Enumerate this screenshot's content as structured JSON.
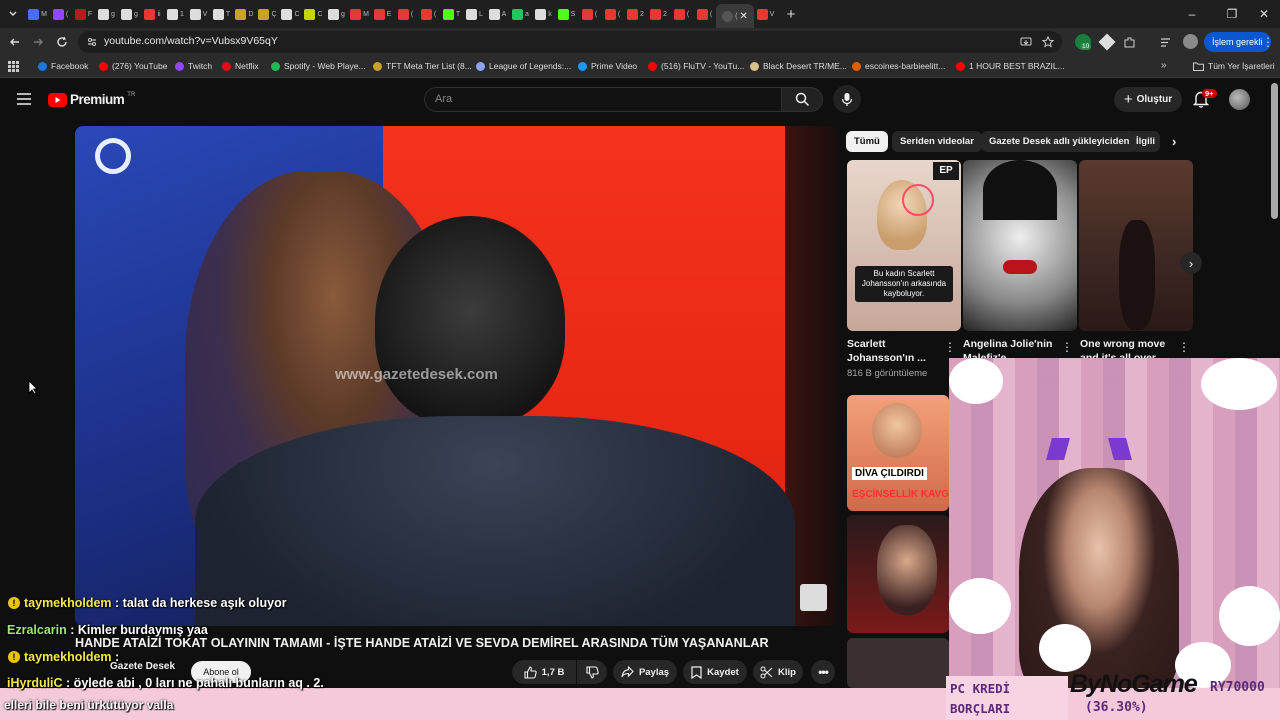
{
  "browser": {
    "tabs": [
      {
        "label": "M",
        "color": "#4a6cf7"
      },
      {
        "label": "(",
        "color": "#9146ff"
      },
      {
        "label": "F",
        "color": "#b71c1c"
      },
      {
        "label": "g",
        "color": "#dddddd"
      },
      {
        "label": "g",
        "color": "#dddddd"
      },
      {
        "label": "ii",
        "color": "#e53935"
      },
      {
        "label": "1",
        "color": "#dddddd"
      },
      {
        "label": "V",
        "color": "#dddddd"
      },
      {
        "label": "T",
        "color": "#dddddd"
      },
      {
        "label": "D",
        "color": "#c9a227"
      },
      {
        "label": "Ç",
        "color": "#c9a227"
      },
      {
        "label": "C",
        "color": "#dddddd"
      },
      {
        "label": "C",
        "color": "#c6d400"
      },
      {
        "label": "g",
        "color": "#dddddd"
      },
      {
        "label": "M",
        "color": "#e53935"
      },
      {
        "label": "E",
        "color": "#e53935"
      },
      {
        "label": "(",
        "color": "#e53935"
      },
      {
        "label": "(",
        "color": "#e53935"
      },
      {
        "label": "T",
        "color": "#53fc18"
      },
      {
        "label": "L",
        "color": "#dddddd"
      },
      {
        "label": "A",
        "color": "#dddddd"
      },
      {
        "label": "a",
        "color": "#22c55e"
      },
      {
        "label": "k",
        "color": "#dddddd"
      },
      {
        "label": "S",
        "color": "#53fc18"
      },
      {
        "label": "(",
        "color": "#e53935"
      },
      {
        "label": "(",
        "color": "#e53935"
      },
      {
        "label": "2",
        "color": "#e53935"
      },
      {
        "label": "2",
        "color": "#e53935"
      },
      {
        "label": "(",
        "color": "#e53935"
      },
      {
        "label": "(",
        "color": "#e53935"
      }
    ],
    "active_tab_label": "(",
    "next_tab_label": "V",
    "url": "youtube.com/watch?v=Vubsx9V65qY",
    "profile_label": "İşlem gerekli",
    "extension_badge": "10",
    "bookmarks": [
      {
        "label": "Facebook",
        "color": "#1877f2"
      },
      {
        "label": "(276) YouTube",
        "color": "#ff0000"
      },
      {
        "label": "Twitch",
        "color": "#9146ff"
      },
      {
        "label": "Netflix",
        "color": "#e50914"
      },
      {
        "label": "Spotify - Web Playe...",
        "color": "#1db954"
      },
      {
        "label": "TFT Meta Tier List (8...",
        "color": "#c9a227"
      },
      {
        "label": "League of Legends:...",
        "color": "#8aa4ff"
      },
      {
        "label": "Prime Video",
        "color": "#1a98ff"
      },
      {
        "label": "(516) FluTV - YouTu...",
        "color": "#ff0000"
      },
      {
        "label": "Black Desert TR/ME...",
        "color": "#d9c08a"
      },
      {
        "label": "escoines-barbieelitt...",
        "color": "#e06000"
      },
      {
        "label": "1 HOUR BEST BRAZIL...",
        "color": "#ff0000"
      }
    ],
    "all_bookmarks_label": "Tüm Yer İşaretleri"
  },
  "youtube": {
    "logo_text": "Premium",
    "logo_region": "TR",
    "search_placeholder": "Ara",
    "create_label": "Oluştur",
    "notif_count": "9+",
    "chips": [
      "Tümü",
      "Seriden videolar",
      "Gazete Desek adlı yükleyiciden",
      "İlgili"
    ],
    "shorts": [
      {
        "title": "Scarlett Johansson'ın ...",
        "views": "816 B görüntüleme",
        "caption": "Bu kadın Scarlett Johansson'ın arkasında kayboluyor.",
        "badge": "EP"
      },
      {
        "title": "Angelina Jolie'nin Malefiz'e",
        "views": ""
      },
      {
        "title": "One wrong move and it's all over",
        "views": ""
      }
    ],
    "side_thumb_caption_top": "DİVA ÇILDIRDI",
    "side_thumb_caption_bottom": "EŞCİNSELLİK KAVG",
    "video_watermark": "www.gazetedesek.com",
    "video_title": "HANDE ATAİZİ TOKAT OLAYININ TAMAMI - İŞTE HANDE ATAİZİ VE SEVDA DEMİREL ARASINDA TÜM YAŞANANLAR",
    "channel_name": "Gazete Desek",
    "subscribe_label": "Abone ol",
    "like_count": "1,7 B",
    "share_label": "Paylaş",
    "save_label": "Kaydet",
    "clip_label": "Klip"
  },
  "stream": {
    "chat": [
      {
        "user": "taymekholdem",
        "message": ": talat da herkese aşık oluyor",
        "badge": "!"
      },
      {
        "user": "Ezralcarin",
        "message": ": Kimler burdaymış yaa",
        "badge": ""
      },
      {
        "user": "taymekholdem",
        "message": ":",
        "badge": "!"
      },
      {
        "user": "iHyrduliC",
        "message": ": öylede abi , 0 ları ne pahalı bunların aq . 2.",
        "badge": ""
      },
      {
        "user": "",
        "message": "elleri bile beni ürkütüyor valla",
        "badge": ""
      }
    ],
    "kredi_line1": "PC KREDİ",
    "kredi_line2": "BORÇLARI",
    "sponsor": "ByNoGame",
    "ry_code": "RY70000",
    "percent": "(36.30%)"
  }
}
